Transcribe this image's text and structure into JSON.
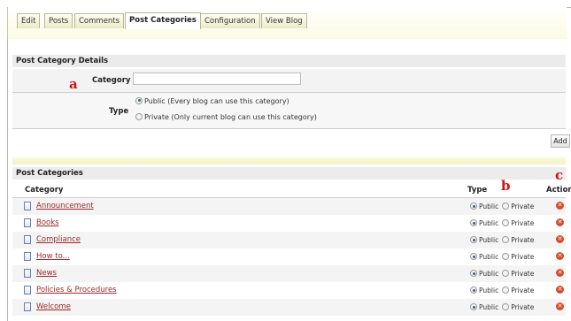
{
  "tabs": [
    {
      "label": "Edit",
      "active": false
    },
    {
      "label": "Posts",
      "active": false
    },
    {
      "label": "Comments",
      "active": false
    },
    {
      "label": "Post Categories",
      "active": true
    },
    {
      "label": "Configuration",
      "active": false
    },
    {
      "label": "View Blog",
      "active": false
    }
  ],
  "details": {
    "title": "Post Category Details",
    "category_label": "Category",
    "category_value": "",
    "type_label": "Type",
    "type_options": [
      {
        "label": "Public (Every blog can use this category)",
        "selected": true
      },
      {
        "label": "Private (Only current blog can use this category)",
        "selected": false
      }
    ],
    "add_label": "Add"
  },
  "list": {
    "title": "Post Categories",
    "columns": {
      "category": "Category",
      "type": "Type",
      "action": "Action"
    },
    "public_label": "Public",
    "private_label": "Private",
    "rows": [
      {
        "name": "Announcement",
        "type": "Public"
      },
      {
        "name": "Books",
        "type": "Public"
      },
      {
        "name": "Compliance",
        "type": "Public"
      },
      {
        "name": "How to...",
        "type": "Public"
      },
      {
        "name": "News",
        "type": "Public"
      },
      {
        "name": "Policies & Procedures",
        "type": "Public"
      },
      {
        "name": "Welcome",
        "type": "Public"
      }
    ]
  },
  "markers": {
    "a": "a",
    "b": "b",
    "c": "c"
  },
  "colors": {
    "link": "#9a2a2a",
    "marker": "#d01010",
    "delete": "#d84a2a"
  },
  "icons": {
    "row_icon": "document-icon",
    "action_icon": "delete-icon"
  }
}
